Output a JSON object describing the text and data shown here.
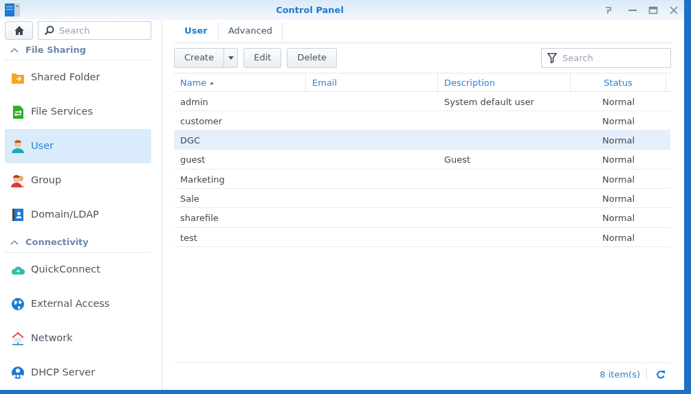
{
  "window": {
    "title": "Control Panel"
  },
  "sidebar": {
    "search": {
      "placeholder": "Search"
    },
    "sections": [
      {
        "label": "File Sharing",
        "expanded": true,
        "items": [
          {
            "label": "Shared Folder",
            "selected": false
          },
          {
            "label": "File Services",
            "selected": false
          },
          {
            "label": "User",
            "selected": true
          },
          {
            "label": "Group",
            "selected": false
          },
          {
            "label": "Domain/LDAP",
            "selected": false
          }
        ]
      },
      {
        "label": "Connectivity",
        "expanded": true,
        "items": [
          {
            "label": "QuickConnect",
            "selected": false
          },
          {
            "label": "External Access",
            "selected": false
          },
          {
            "label": "Network",
            "selected": false
          },
          {
            "label": "DHCP Server",
            "selected": false
          }
        ]
      }
    ]
  },
  "tabs": [
    {
      "label": "User",
      "selected": true
    },
    {
      "label": "Advanced",
      "selected": false
    }
  ],
  "toolbar": {
    "buttons": [
      "Create",
      "Edit",
      "Delete"
    ],
    "search": {
      "placeholder": "Search"
    }
  },
  "table": {
    "columns": [
      {
        "label": "Name",
        "sorted": true
      },
      {
        "label": "Email",
        "sorted": false
      },
      {
        "label": "Description",
        "sorted": false
      },
      {
        "label": "Status",
        "sorted": false
      }
    ],
    "rows": [
      {
        "cells": [
          "admin",
          "",
          "System default user",
          "Normal"
        ],
        "selected": false
      },
      {
        "cells": [
          "customer",
          "",
          "",
          "Normal"
        ],
        "selected": false
      },
      {
        "cells": [
          "DGC",
          "",
          "",
          "Normal"
        ],
        "selected": true
      },
      {
        "cells": [
          "guest",
          "",
          "Guest",
          "Normal"
        ],
        "selected": false
      },
      {
        "cells": [
          "Marketing",
          "",
          "",
          "Normal"
        ],
        "selected": false
      },
      {
        "cells": [
          "Sale",
          "",
          "",
          "Normal"
        ],
        "selected": false
      },
      {
        "cells": [
          "sharefile",
          "",
          "",
          "Normal"
        ],
        "selected": false
      },
      {
        "cells": [
          "test",
          "",
          "",
          "Normal"
        ],
        "selected": false
      }
    ]
  },
  "status_bar": {
    "count": "8 item(s)"
  }
}
